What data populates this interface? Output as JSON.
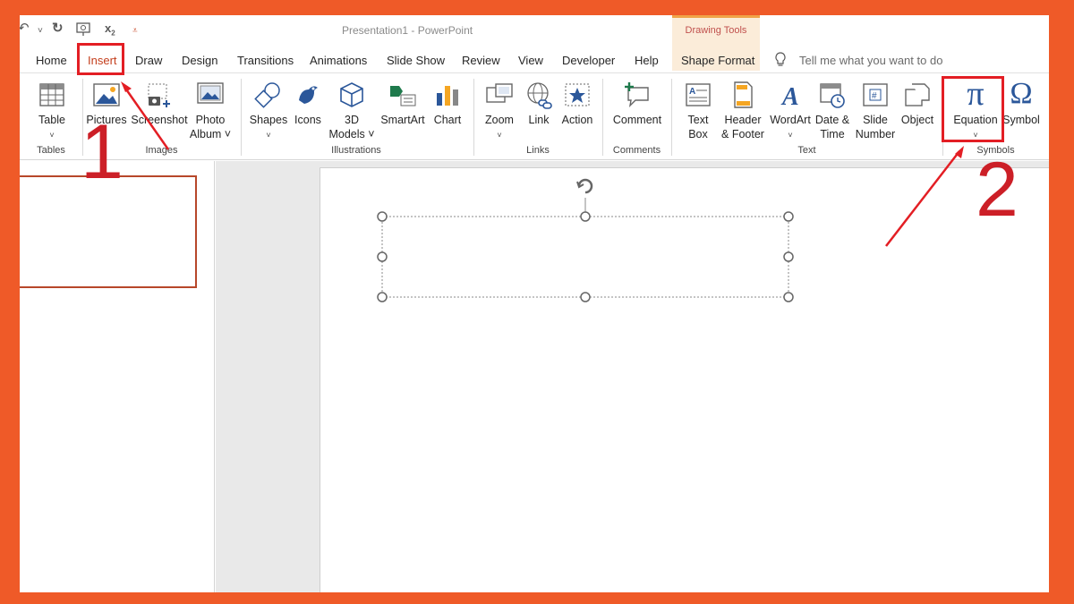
{
  "window": {
    "title": "Presentation1  -  PowerPoint",
    "contextual_group": "Drawing Tools",
    "contextual_tab": "Shape Format"
  },
  "tabs": [
    "Home",
    "Insert",
    "Draw",
    "Design",
    "Transitions",
    "Animations",
    "Slide Show",
    "Review",
    "View",
    "Developer",
    "Help"
  ],
  "active_tab": "Insert",
  "tell_me": "Tell me what you want to do",
  "ribbon": {
    "table": {
      "line1": "Table",
      "caret": "˅",
      "group": "Tables"
    },
    "pictures": {
      "line1": "Pictures"
    },
    "screenshot": {
      "line1": "Screenshot"
    },
    "photo_album": {
      "line1": "Photo",
      "line2": "Album ˅"
    },
    "images_group": "Images",
    "shapes": {
      "line1": "Shapes",
      "caret": "˅"
    },
    "icons": {
      "line1": "Icons"
    },
    "models3d": {
      "line1": "3D",
      "line2": "Models ˅"
    },
    "smartart": {
      "line1": "SmartArt"
    },
    "chart": {
      "line1": "Chart"
    },
    "illustrations_group": "Illustrations",
    "zoom": {
      "line1": "Zoom",
      "caret": "˅"
    },
    "link": {
      "line1": "Link"
    },
    "action": {
      "line1": "Action"
    },
    "links_group": "Links",
    "comment": {
      "line1": "Comment"
    },
    "comments_group": "Comments",
    "textbox": {
      "line1": "Text",
      "line2": "Box"
    },
    "header_footer": {
      "line1": "Header",
      "line2": "& Footer"
    },
    "wordart": {
      "line1": "WordArt",
      "caret": "˅"
    },
    "datetime": {
      "line1": "Date &",
      "line2": "Time"
    },
    "slide_number": {
      "line1": "Slide",
      "line2": "Number"
    },
    "object": {
      "line1": "Object"
    },
    "text_group": "Text",
    "equation": {
      "line1": "Equation",
      "caret": "˅",
      "glyph": "π"
    },
    "symbol": {
      "line1": "Symbol",
      "glyph": "Ω"
    },
    "symbols_group": "Symbols"
  },
  "annotations": {
    "step1": "1",
    "step2": "2"
  },
  "colors": {
    "frame": "#ef5a28",
    "accent": "#c43e1c",
    "annotation_red": "#e31e24",
    "icon_blue": "#2b579a"
  }
}
